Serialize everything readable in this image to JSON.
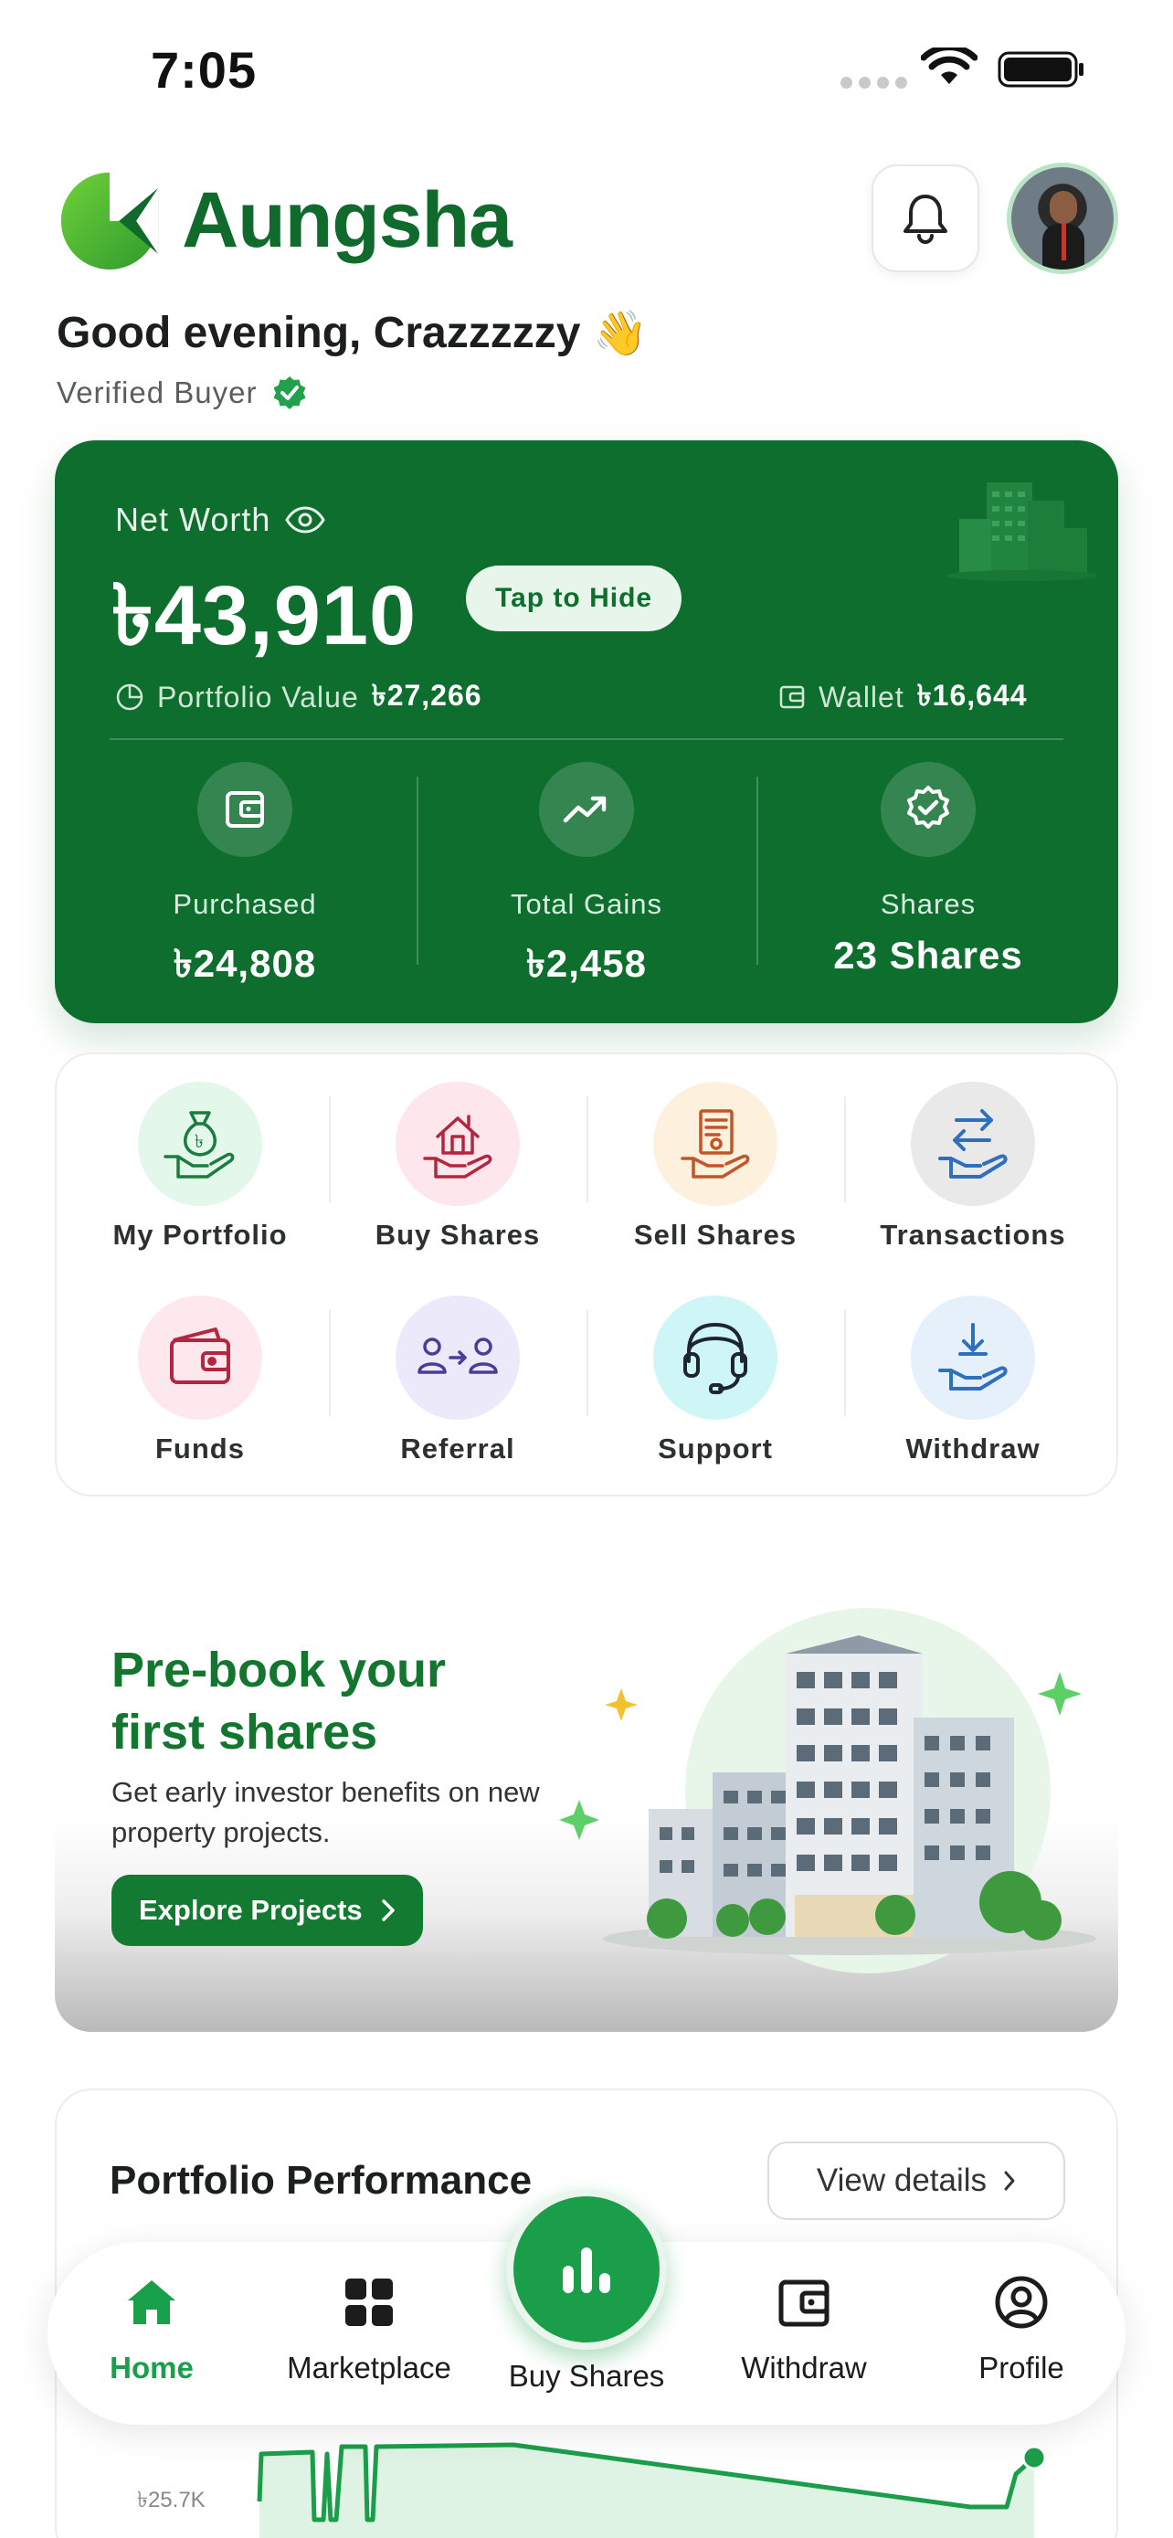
{
  "status_bar": {
    "time": "7:05"
  },
  "header": {
    "brand": "Aungsha"
  },
  "greeting": {
    "text": "Good evening, Crazzzzzy",
    "emoji": "👋",
    "role": "Verified Buyer"
  },
  "net_worth": {
    "label": "Net Worth",
    "amount": "৳43,910",
    "hide_label": "Tap to Hide",
    "portfolio_label": "Portfolio Value",
    "portfolio_value": "৳27,266",
    "wallet_label": "Wallet",
    "wallet_value": "৳16,644",
    "stats": [
      {
        "label": "Purchased",
        "value": "৳24,808",
        "icon": "wallet-icon"
      },
      {
        "label": "Total Gains",
        "value": "৳2,458",
        "icon": "trending-up-icon"
      },
      {
        "label": "Shares",
        "value": "23 Shares",
        "icon": "badge-check-icon"
      }
    ]
  },
  "quick_actions": [
    {
      "label": "My Portfolio",
      "icon": "money-bag-hand-icon",
      "color": "#e3f7ea"
    },
    {
      "label": "Buy Shares",
      "icon": "house-hand-icon",
      "color": "#fde6ec"
    },
    {
      "label": "Sell Shares",
      "icon": "document-hand-icon",
      "color": "#fdf0dc"
    },
    {
      "label": "Transactions",
      "icon": "exchange-hand-icon",
      "color": "#e9e9e9"
    },
    {
      "label": "Funds",
      "icon": "wallet-icon",
      "color": "#fde8ee"
    },
    {
      "label": "Referral",
      "icon": "referral-icon",
      "color": "#ece9fb"
    },
    {
      "label": "Support",
      "icon": "headset-icon",
      "color": "#cff6f7"
    },
    {
      "label": "Withdraw",
      "icon": "withdraw-hand-icon",
      "color": "#e6f0fb"
    }
  ],
  "promo": {
    "title_line1": "Pre-book your",
    "title_line2": "first shares",
    "subtitle": "Get early investor benefits on new property projects.",
    "button": "Explore Projects"
  },
  "performance": {
    "title": "Portfolio Performance",
    "view_details": "View details",
    "y_tick": "৳25.7K"
  },
  "bottom_nav": {
    "items": [
      {
        "label": "Home",
        "icon": "home-icon",
        "active": true
      },
      {
        "label": "Marketplace",
        "icon": "grid-icon",
        "active": false
      },
      {
        "label": "Buy Shares",
        "icon": "bar-chart-icon",
        "active": false
      },
      {
        "label": "Withdraw",
        "icon": "wallet-icon",
        "active": false
      },
      {
        "label": "Profile",
        "icon": "user-circle-icon",
        "active": false
      }
    ]
  },
  "colors": {
    "primary": "#0e6e2e",
    "accent": "#1b9e49"
  }
}
